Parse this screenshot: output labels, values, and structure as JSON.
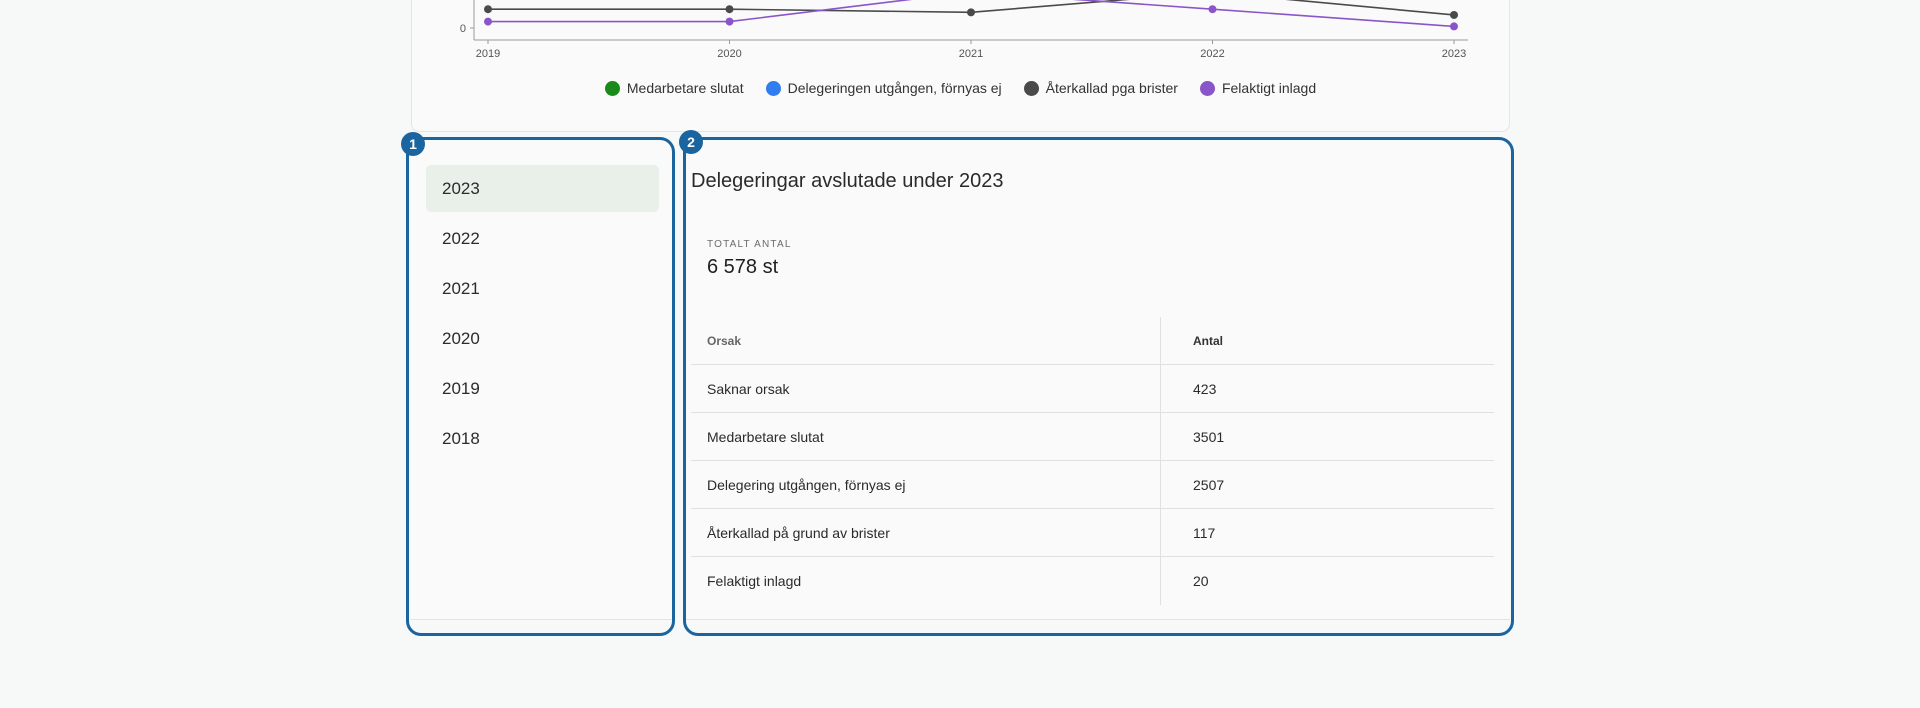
{
  "chart_data": {
    "type": "line",
    "x": [
      "2019",
      "2020",
      "2021",
      "2022",
      "2023"
    ],
    "y_tick_label": "0",
    "series": [
      {
        "name": "Medarbetare slutat",
        "color": "#1a8a1a",
        "values": []
      },
      {
        "name": "Delegeringen utgången, förnyas ej",
        "color": "#2f7df0",
        "values": []
      },
      {
        "name": "Återkallad pga brister",
        "color": "#4a4a4a",
        "values": [
          235,
          235,
          196,
          445,
          163
        ]
      },
      {
        "name": "Felaktigt inlagd",
        "color": "#8a55c8",
        "values": [
          80,
          80,
          450,
          235,
          20
        ]
      }
    ],
    "ylim": [
      0,
      2800
    ]
  },
  "sidebar": {
    "years": [
      "2023",
      "2022",
      "2021",
      "2020",
      "2019",
      "2018"
    ],
    "selected": "2023"
  },
  "detail": {
    "title": "Delegeringar avslutade under 2023",
    "total_label": "TOTALT ANTAL",
    "total_value": "6 578 st",
    "columns": [
      "Orsak",
      "Antal"
    ],
    "rows": [
      {
        "reason": "Saknar orsak",
        "count": "423"
      },
      {
        "reason": "Medarbetare slutat",
        "count": "3501"
      },
      {
        "reason": "Delegering utgången, förnyas ej",
        "count": "2507"
      },
      {
        "reason": "Återkallad på grund av brister",
        "count": "117"
      },
      {
        "reason": "Felaktigt inlagd",
        "count": "20"
      }
    ]
  },
  "annotations": {
    "badge_1": "1",
    "badge_2": "2",
    "color": "#1a64a0"
  }
}
